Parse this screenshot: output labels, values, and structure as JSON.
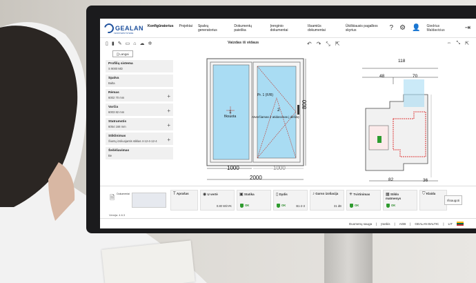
{
  "app": {
    "logo_text": "GEALAN",
    "logo_sub": "FENSTERSYSTEME"
  },
  "nav": [
    "Konfigūratorius",
    "Projektai",
    "Spalvų generatorius",
    "Dokumentų paieška",
    "Įrenginio dokumentai",
    "Išsamiūs dokumentai",
    "Ūkiškiausis pagalbos skyrius"
  ],
  "user": {
    "name": "Giedrius Maldavicius"
  },
  "sidebar": {
    "views_button": "[] Langai",
    "panels": [
      {
        "title": "Profilių sistema",
        "value": "S 9000 MD",
        "has_add": false
      },
      {
        "title": "Spalva",
        "value": "Balta",
        "has_add": false
      },
      {
        "title": "Rėmas",
        "value": "6002 70 mm",
        "has_add": true
      },
      {
        "title": "Varčia",
        "value": "6003 82 mm",
        "has_add": true
      },
      {
        "title": "Statramstis",
        "value": "6054 168 mm",
        "has_add": true
      },
      {
        "title": "Stiklinimas",
        "value": "Šiuntų izoliuojantis stiklas 4-12-4-12-4",
        "has_add": true
      },
      {
        "title": "Šešėliavimas",
        "value": "Be",
        "has_add": false
      }
    ]
  },
  "canvas": {
    "title": "Vaizdas iš vidaus",
    "left_label_num": "1",
    "left_label": "fiksuota",
    "right_label_top": "Pr. 1 (F/R)",
    "right_label_num": "2",
    "right_label": "Atverčiamas ir atidaromas į dešinę",
    "dim_left": "1000",
    "dim_right": "1000",
    "dim_total": "2000",
    "dim_height": "800"
  },
  "section": {
    "dim_total": "118",
    "dim_a": "48",
    "dim_b": "70",
    "dim_bottom": "82",
    "dim_side": "36"
  },
  "bottom": {
    "documents_label": "Dokumentai",
    "props": [
      {
        "label": "Aprašas",
        "value": "",
        "ok": ""
      },
      {
        "label": "U vertė",
        "value": "0.80 W/m²K",
        "ok": ""
      },
      {
        "label": "Statika",
        "value": "",
        "ok": "OK"
      },
      {
        "label": "Dydis",
        "value": "B1-2-3",
        "ok": "OK"
      },
      {
        "label": "Garso izoliacija",
        "value": "31 dB",
        "ok": ""
      },
      {
        "label": "Tvirtinimas",
        "value": "",
        "ok": "OK"
      },
      {
        "label": "Stiklo matmenys",
        "value": "",
        "ok": "OK"
      },
      {
        "label": "Klaida",
        "value": "",
        "ok": ""
      }
    ],
    "check_button": "Išsaugoti"
  },
  "version": "Versija: 4.6.3",
  "footer": [
    "Duomenų sauga",
    "Įrankis",
    "AGB",
    "GEALAN BALTIC",
    "LIT"
  ]
}
